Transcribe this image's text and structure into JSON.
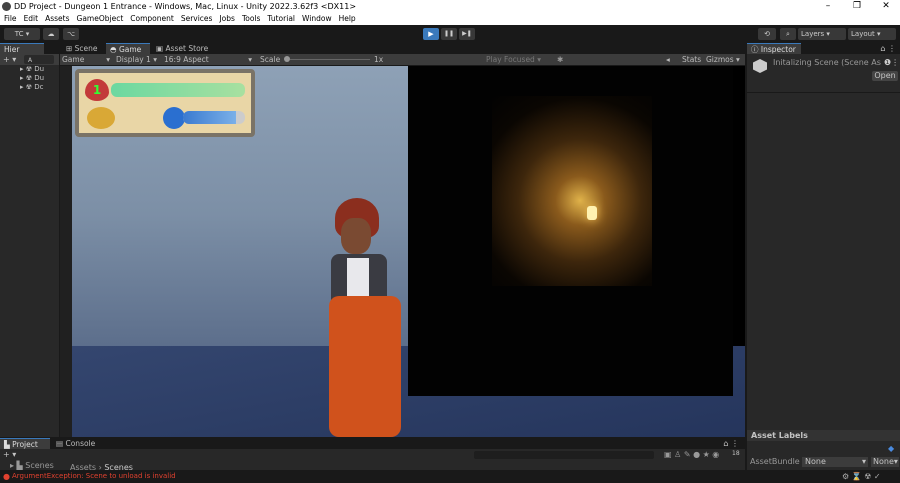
{
  "window": {
    "title": "DD Project - Dungeon 1 Entrance - Windows, Mac, Linux - Unity 2022.3.62f3 <DX11>",
    "min": "–",
    "max": "❐",
    "close": "✕"
  },
  "menu": [
    "File",
    "Edit",
    "Assets",
    "GameObject",
    "Component",
    "Services",
    "Jobs",
    "Tools",
    "Tutorial",
    "Window",
    "Help"
  ],
  "toolbar": {
    "account": "TC ▾",
    "cloud": "☁",
    "collab": "⌥",
    "play": "▶",
    "pause": "❚❚",
    "step": "▶❚",
    "history": "⟲",
    "search": "⌕",
    "layers": "Layers",
    "layout": "Layout",
    "accent": "#3a79bb"
  },
  "hierarchy": {
    "tab": "Hier",
    "items": [
      "Du",
      "Du",
      "Dc"
    ],
    "add": "+ ▾",
    "search": "A"
  },
  "center_tabs": [
    "Scene",
    "Game",
    "Asset Store"
  ],
  "game_toolbar": {
    "mode": "Game",
    "display": "Display 1",
    "aspect": "16:9 Aspect",
    "scale_label": "Scale",
    "scale_value": "1x",
    "play_focused": "Play Focused",
    "stats": "Stats",
    "gizmos": "Gizmos"
  },
  "hud": {
    "health_number": "1",
    "health_fill": 1.0,
    "mana_fill": 0.85
  },
  "inspector": {
    "tab": "Inspector",
    "object": "Initalizing Scene (Scene Ass‹",
    "open": "Open",
    "asset_labels": "Asset Labels",
    "asset_bundle": "AssetBundle",
    "bundle_value": "None",
    "variant_value": "None"
  },
  "project": {
    "tabs": [
      "Project",
      "Console"
    ],
    "folder": "Scenes",
    "breadcrumb": [
      "Assets",
      "Scenes"
    ],
    "add": "+ ▾",
    "count": "18"
  },
  "status": {
    "error": "ArgumentException: Scene to unload is invalid",
    "error_color": "#e0412f"
  }
}
